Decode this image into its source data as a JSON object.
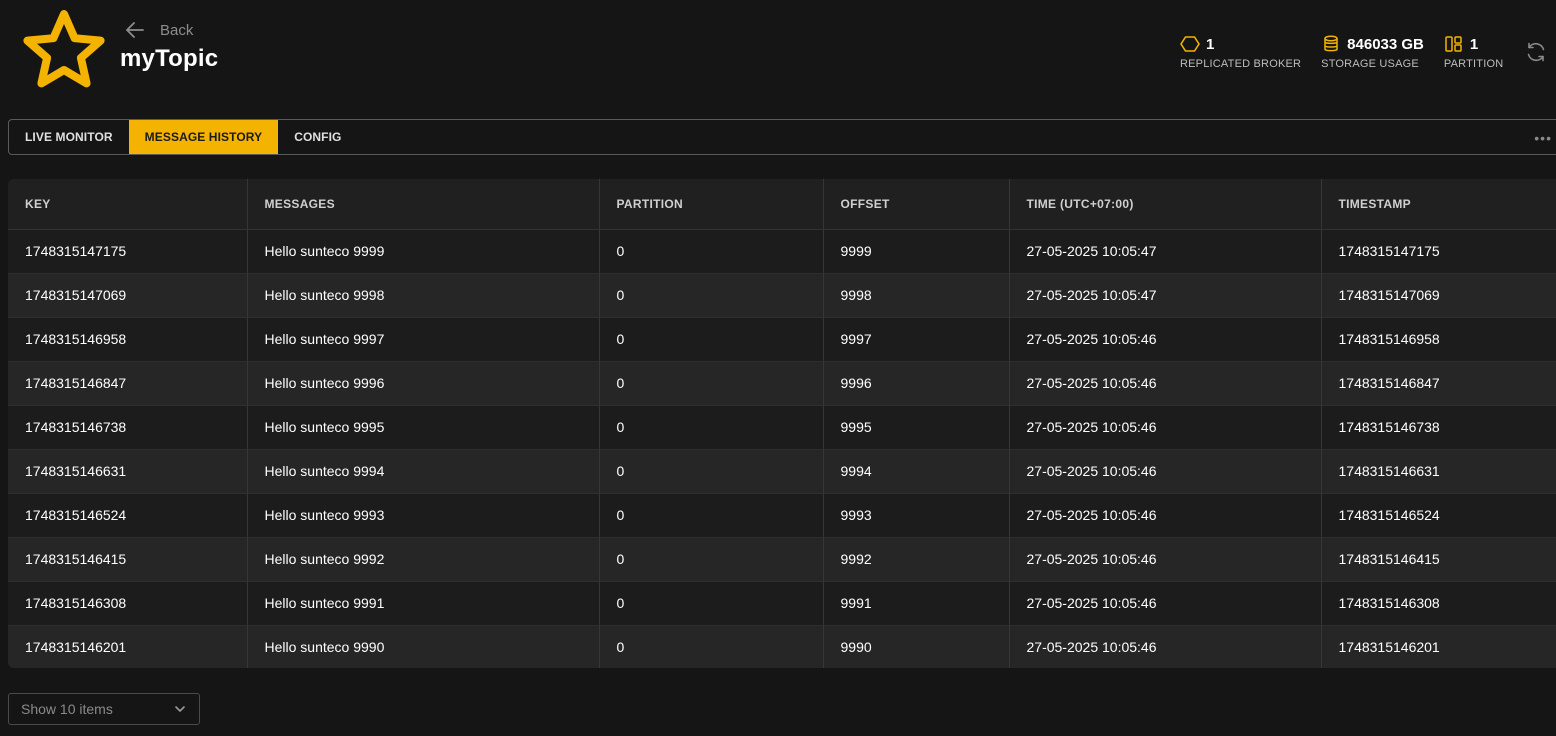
{
  "header": {
    "back_label": "Back",
    "title": "myTopic",
    "stats": [
      {
        "icon": "hexagon-icon",
        "value": "1",
        "label": "REPLICATED BROKER"
      },
      {
        "icon": "database-icon",
        "value": "846033 GB",
        "label": "STORAGE USAGE"
      },
      {
        "icon": "partition-icon",
        "value": "1",
        "label": "PARTITION"
      }
    ]
  },
  "accent_color": "#f5b301",
  "tabs": [
    {
      "label": "LIVE MONITOR",
      "active": false
    },
    {
      "label": "MESSAGE HISTORY",
      "active": true
    },
    {
      "label": "CONFIG",
      "active": false
    }
  ],
  "table": {
    "columns": [
      "KEY",
      "MESSAGES",
      "PARTITION",
      "OFFSET",
      "TIME (UTC+07:00)",
      "TIMESTAMP"
    ],
    "rows": [
      [
        "1748315147175",
        "Hello sunteco 9999",
        "0",
        "9999",
        "27-05-2025 10:05:47",
        "1748315147175"
      ],
      [
        "1748315147069",
        "Hello sunteco 9998",
        "0",
        "9998",
        "27-05-2025 10:05:47",
        "1748315147069"
      ],
      [
        "1748315146958",
        "Hello sunteco 9997",
        "0",
        "9997",
        "27-05-2025 10:05:46",
        "1748315146958"
      ],
      [
        "1748315146847",
        "Hello sunteco 9996",
        "0",
        "9996",
        "27-05-2025 10:05:46",
        "1748315146847"
      ],
      [
        "1748315146738",
        "Hello sunteco 9995",
        "0",
        "9995",
        "27-05-2025 10:05:46",
        "1748315146738"
      ],
      [
        "1748315146631",
        "Hello sunteco 9994",
        "0",
        "9994",
        "27-05-2025 10:05:46",
        "1748315146631"
      ],
      [
        "1748315146524",
        "Hello sunteco 9993",
        "0",
        "9993",
        "27-05-2025 10:05:46",
        "1748315146524"
      ],
      [
        "1748315146415",
        "Hello sunteco 9992",
        "0",
        "9992",
        "27-05-2025 10:05:46",
        "1748315146415"
      ],
      [
        "1748315146308",
        "Hello sunteco 9991",
        "0",
        "9991",
        "27-05-2025 10:05:46",
        "1748315146308"
      ],
      [
        "1748315146201",
        "Hello sunteco 9990",
        "0",
        "9990",
        "27-05-2025 10:05:46",
        "1748315146201"
      ]
    ]
  },
  "pagination": {
    "page_size_label": "Show 10 items"
  }
}
